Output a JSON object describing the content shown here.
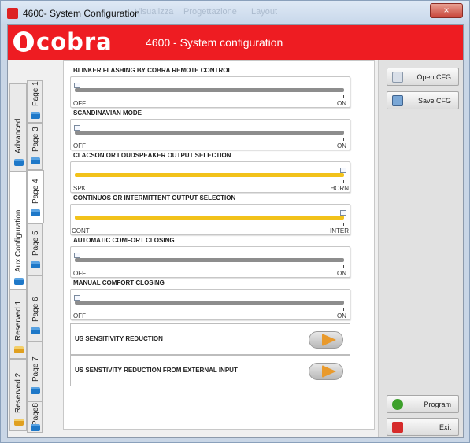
{
  "window": {
    "title": "4600- System Configuration",
    "ghost_title_1": "Visualizza",
    "ghost_title_2": "Progettazione",
    "ghost_title_3": "Layout",
    "close_label": "×"
  },
  "header": {
    "brand": "cobra",
    "title": "4600 - System configuration",
    "accent_color": "#ee1c22"
  },
  "side_tabs": {
    "groups": [
      {
        "label": "Advanced",
        "icon": "briefcase-icon"
      },
      {
        "label": "Aux Configuration",
        "icon": "briefcase-icon"
      },
      {
        "label": "Reserved 1",
        "icon": "lock-icon"
      },
      {
        "label": "Reserved 2",
        "icon": "lock-icon"
      }
    ],
    "pages": [
      {
        "label": "Page 1",
        "icon": "briefcase-icon"
      },
      {
        "label": "Page 3",
        "icon": "briefcase-icon"
      },
      {
        "label": "Page 4",
        "icon": "briefcase-icon"
      },
      {
        "label": "Page 5",
        "icon": "briefcase-icon"
      },
      {
        "label": "Page 6",
        "icon": "briefcase-icon"
      },
      {
        "label": "Page 7",
        "icon": "briefcase-icon"
      },
      {
        "label": "Page8",
        "icon": "briefcase-icon"
      }
    ]
  },
  "settings": [
    {
      "title": "BLINKER FLASHING BY COBRA REMOTE CONTROL",
      "min": "OFF",
      "max": "ON",
      "value_fraction": 0.0
    },
    {
      "title": "SCANDINAVIAN MODE",
      "min": "OFF",
      "max": "ON",
      "value_fraction": 0.0
    },
    {
      "title": "CLACSON OR LOUDSPEAKER OUTPUT SELECTION",
      "min": "SPK",
      "max": "HORN",
      "value_fraction": 1.0
    },
    {
      "title": "CONTINUOS OR INTERMITTENT OUTPUT SELECTION",
      "min": "CONT",
      "max": "INTER",
      "value_fraction": 1.0
    },
    {
      "title": "AUTOMATIC COMFORT CLOSING",
      "min": "OFF",
      "max": "ON",
      "value_fraction": 0.0
    },
    {
      "title": "MANUAL COMFORT CLOSING",
      "min": "OFF",
      "max": "ON",
      "value_fraction": 0.0
    }
  ],
  "toggles": [
    {
      "label": "US SENSITIVITY REDUCTION"
    },
    {
      "label": "US SENSTIVITY REDUCTION FROM EXTERNAL INPUT"
    }
  ],
  "buttons": {
    "open_cfg": "Open CFG",
    "save_cfg": "Save CFG",
    "program": "Program",
    "exit": "Exit"
  }
}
